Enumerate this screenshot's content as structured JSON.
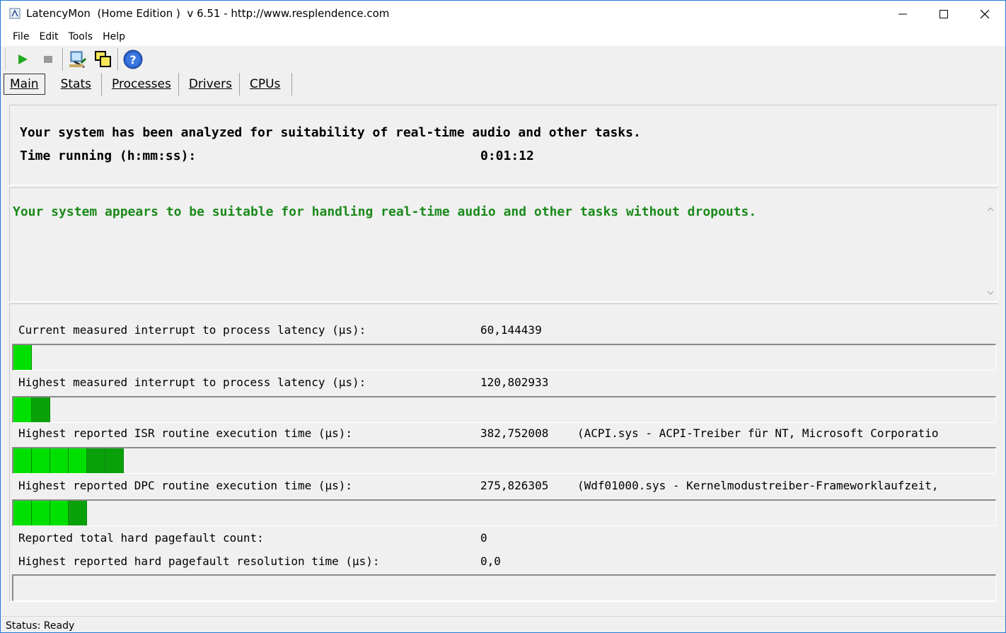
{
  "window": {
    "title": "LatencyMon  (Home Edition )  v 6.51 - http://www.resplendence.com"
  },
  "menu": [
    "File",
    "Edit",
    "Tools",
    "Help"
  ],
  "tabs": [
    "Main",
    "Stats",
    "Processes",
    "Drivers",
    "CPUs"
  ],
  "summary": {
    "line1": "Your system has been analyzed for suitability of real-time audio and other tasks.",
    "running_label": "Time running (h:mm:ss):",
    "running_value": "0:01:12"
  },
  "verdict": {
    "text": "Your system appears to be suitable for handling real-time audio and other tasks without dropouts.",
    "color": "#1a8a1a"
  },
  "metrics": [
    {
      "label": "Current measured interrupt to process latency (µs):",
      "value": "60,144439",
      "detail": "",
      "bar_segments": 1
    },
    {
      "label": "Highest measured interrupt to process latency (µs):",
      "value": "120,802933",
      "detail": "",
      "bar_segments": 2
    },
    {
      "label": "Highest reported ISR routine execution time (µs):",
      "value": "382,752008",
      "detail": "(ACPI.sys - ACPI-Treiber für NT, Microsoft Corporatio",
      "bar_segments": 6
    },
    {
      "label": "Highest reported DPC routine execution time (µs):",
      "value": "275,826305",
      "detail": "(Wdf01000.sys - Kernelmodustreiber-Frameworklaufzeit,",
      "bar_segments": 4
    },
    {
      "label": "Reported total hard pagefault count:",
      "value": "0",
      "detail": ""
    },
    {
      "label": "Highest reported hard pagefault resolution time (µs):",
      "value": "0,0",
      "detail": "",
      "bar_segments": 0
    }
  ],
  "status": "Status: Ready",
  "colors": {
    "bar_green": "#00e000",
    "bar_green_dark": "#0aa00a",
    "verdict_green": "#1a8a1a"
  },
  "icons": {
    "start": "play-icon",
    "stop": "stop-icon",
    "tool": "kernel-debug-icon",
    "windows": "window-stack-icon",
    "help": "help-icon"
  }
}
